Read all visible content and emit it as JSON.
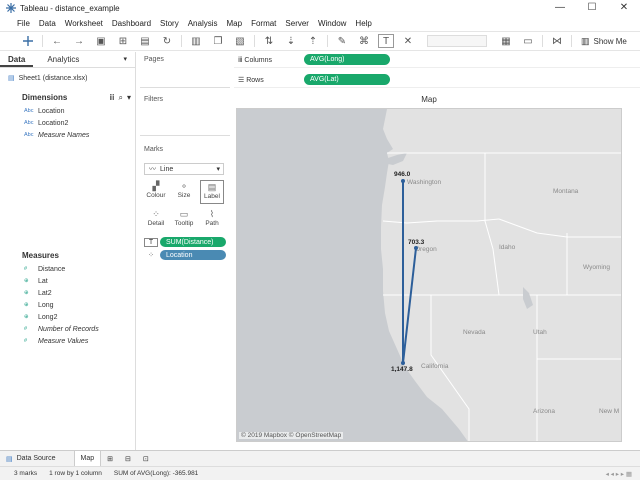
{
  "window": {
    "title": "Tableau - distance_example",
    "controls": [
      "—",
      "☐",
      "✕"
    ]
  },
  "menu": [
    "File",
    "Data",
    "Worksheet",
    "Dashboard",
    "Story",
    "Analysis",
    "Map",
    "Format",
    "Server",
    "Window",
    "Help"
  ],
  "toolbar": {
    "show_me": "Show Me"
  },
  "left_pane": {
    "tabs": {
      "data": "Data",
      "analytics": "Analytics"
    },
    "source": "Sheet1 (distance.xlsx)",
    "dimensions_label": "Dimensions",
    "dimensions": [
      {
        "type": "Abc",
        "name": "Location"
      },
      {
        "type": "Abc",
        "name": "Location2"
      },
      {
        "type": "Abc",
        "name": "Measure Names"
      }
    ],
    "measures_label": "Measures",
    "measures": [
      {
        "type": "#",
        "name": "Distance"
      },
      {
        "type": "⊕",
        "name": "Lat"
      },
      {
        "type": "⊕",
        "name": "Lat2"
      },
      {
        "type": "⊕",
        "name": "Long"
      },
      {
        "type": "⊕",
        "name": "Long2"
      },
      {
        "type": "#",
        "name": "Number of Records"
      },
      {
        "type": "#",
        "name": "Measure Values"
      }
    ]
  },
  "cards": {
    "pages": "Pages",
    "filters": "Filters",
    "marks": "Marks",
    "mark_type": "Line",
    "buttons": {
      "colour": "Colour",
      "size": "Size",
      "label": "Label",
      "detail": "Detail",
      "tooltip": "Tooltip",
      "path": "Path"
    },
    "pill_label": "SUM(Distance)",
    "pill_detail": "Location"
  },
  "shelves": {
    "columns_label": "Columns",
    "columns_pill": "AVG(Long)",
    "rows_label": "Rows",
    "rows_pill": "AVG(Lat)"
  },
  "view": {
    "title": "Map",
    "states": [
      "Washington",
      "Montana",
      "Oregon",
      "Idaho",
      "Wyoming",
      "Nevada",
      "Utah",
      "California",
      "Arizona",
      "New M"
    ],
    "points": [
      {
        "label": "946.0"
      },
      {
        "label": "703.3"
      },
      {
        "label": "1,147.8"
      }
    ],
    "attribution": "© 2019 Mapbox © OpenStreetMap",
    "colors": {
      "line": "#2d5f9a",
      "land": "#e2e2e2",
      "water": "#c9ccd0",
      "border": "#ffffff"
    }
  },
  "sheet_tabs": {
    "data_source": "Data Source",
    "active": "Map"
  },
  "status": {
    "marks": "3 marks",
    "rows": "1 row by 1 column",
    "sum": "SUM of AVG(Long): -365.981"
  }
}
